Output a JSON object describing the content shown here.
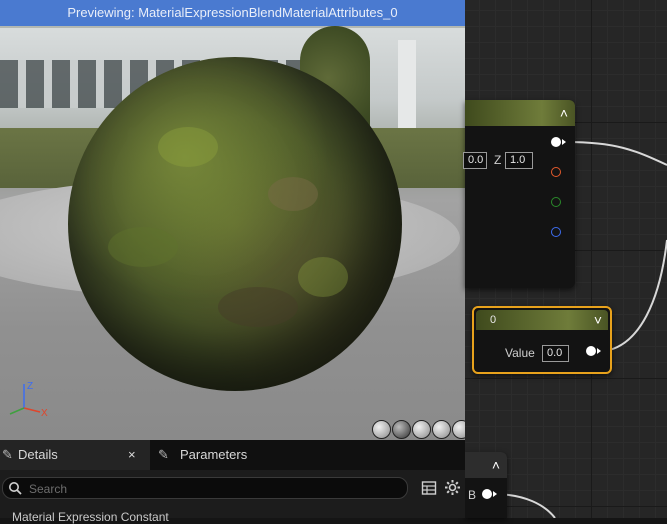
{
  "viewport": {
    "title": "Previewing: MaterialExpressionBlendMaterialAttributes_0",
    "axes": {
      "z": "Z",
      "x": "X"
    },
    "view_buttons": [
      "cylinder-icon",
      "sphere-icon",
      "plane-icon",
      "cube-icon",
      "mesh-icon"
    ]
  },
  "graph": {
    "node_top": {
      "collapse_icon": "chevron-up-icon",
      "x_value": "0.0",
      "z_label": "Z",
      "z_value": "1.0",
      "pin_colors": [
        "#ffffff",
        "#e55a2b",
        "#2a8a2a",
        "#3d6df0"
      ]
    },
    "node_scalar": {
      "title": "0",
      "value_label": "Value",
      "value": "0.0",
      "collapse_icon": "chevron-down-icon",
      "border_color": "#e8a21c"
    },
    "node_bottom": {
      "pin_label": "B",
      "collapse_icon": "chevron-up-icon"
    }
  },
  "details": {
    "tabs": [
      {
        "label": "Details",
        "icon": "pencil-icon",
        "close": "×"
      },
      {
        "label": "Parameters",
        "icon": "pencil-icon"
      }
    ],
    "search_placeholder": "Search",
    "category_label": "Material Expression Constant"
  },
  "colors": {
    "title_bar": "#4a7ad0",
    "axis_z": "#3d6df0",
    "axis_x": "#e0452b",
    "axis_y": "#3fa03f"
  }
}
